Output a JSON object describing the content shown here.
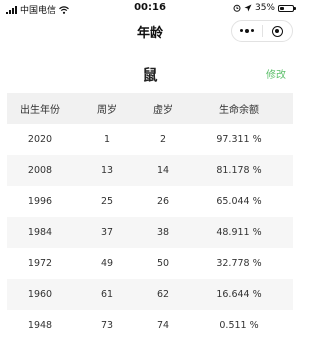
{
  "status_bar": {
    "carrier": "中国电信",
    "time": "00:16",
    "battery_percent": "35%",
    "battery_level": 0.35
  },
  "nav": {
    "title": "年龄"
  },
  "main": {
    "zodiac": "鼠",
    "edit_label": "修改"
  },
  "table": {
    "headers": [
      "出生年份",
      "周岁",
      "虚岁",
      "生命余额"
    ],
    "rows": [
      [
        "2020",
        "1",
        "2",
        "97.311 %"
      ],
      [
        "2008",
        "13",
        "14",
        "81.178 %"
      ],
      [
        "1996",
        "25",
        "26",
        "65.044 %"
      ],
      [
        "1984",
        "37",
        "38",
        "48.911 %"
      ],
      [
        "1972",
        "49",
        "50",
        "32.778 %"
      ],
      [
        "1960",
        "61",
        "62",
        "16.644 %"
      ],
      [
        "1948",
        "73",
        "74",
        "0.511 %"
      ]
    ]
  },
  "colors": {
    "accent_green": "#5cbf6a",
    "header_bg": "#f1f1f1",
    "alt_row_bg": "#f6f6f6"
  },
  "icons": [
    "signal-icon",
    "wifi-icon",
    "location-icon",
    "alarm-icon",
    "battery-icon",
    "more-icon",
    "close-target-icon"
  ]
}
